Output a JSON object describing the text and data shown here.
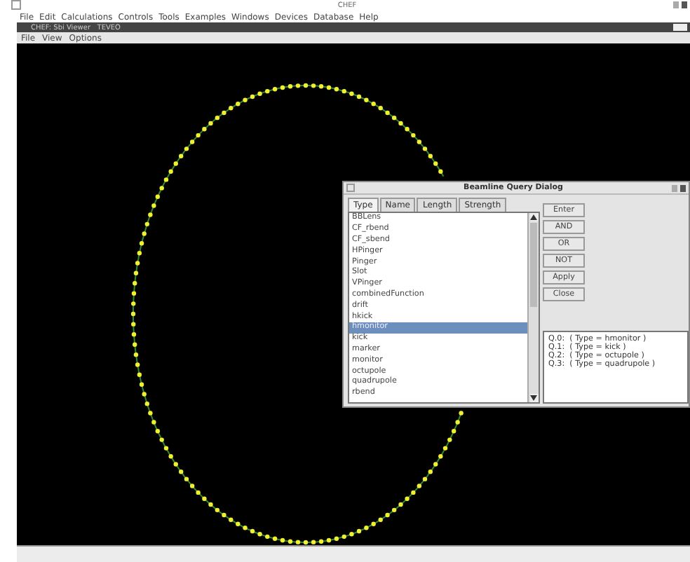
{
  "window": {
    "title": "CHEF"
  },
  "menu": [
    "File",
    "Edit",
    "Calculations",
    "Controls",
    "Tools",
    "Examples",
    "Windows",
    "Devices",
    "Database",
    "Help"
  ],
  "viewer": {
    "title": "CHEF: Sbi Viewer   TEVEO",
    "menu": [
      "File",
      "View",
      "Options"
    ]
  },
  "dialog": {
    "title": "Beamline Query Dialog",
    "tabs": [
      {
        "label": "Type",
        "selected": true
      },
      {
        "label": "Name",
        "selected": false
      },
      {
        "label": "Length",
        "selected": false
      },
      {
        "label": "Strength",
        "selected": false
      }
    ],
    "items": [
      {
        "label": "BBLens",
        "selected": false
      },
      {
        "label": "CF_rbend",
        "selected": false
      },
      {
        "label": "CF_sbend",
        "selected": false
      },
      {
        "label": "HPinger",
        "selected": false
      },
      {
        "label": "Pinger",
        "selected": false
      },
      {
        "label": "Slot",
        "selected": false
      },
      {
        "label": "VPinger",
        "selected": false
      },
      {
        "label": "combinedFunction",
        "selected": false
      },
      {
        "label": "drift",
        "selected": false
      },
      {
        "label": "hkick",
        "selected": false
      },
      {
        "label": "hmonitor",
        "selected": true
      },
      {
        "label": "kick",
        "selected": false
      },
      {
        "label": "marker",
        "selected": false
      },
      {
        "label": "monitor",
        "selected": false
      },
      {
        "label": "octupole",
        "selected": false
      },
      {
        "label": "quadrupole",
        "selected": false
      },
      {
        "label": "rbend",
        "selected": false
      }
    ],
    "buttons": [
      "Enter",
      "AND",
      "OR",
      "NOT",
      "Apply",
      "Close"
    ],
    "queries": [
      "Q.0:  ( Type = hmonitor )",
      "Q.1:  ( Type = kick )",
      "Q.2:  ( Type = octupole )",
      "Q.3:  ( Type = quadrupole )"
    ]
  }
}
